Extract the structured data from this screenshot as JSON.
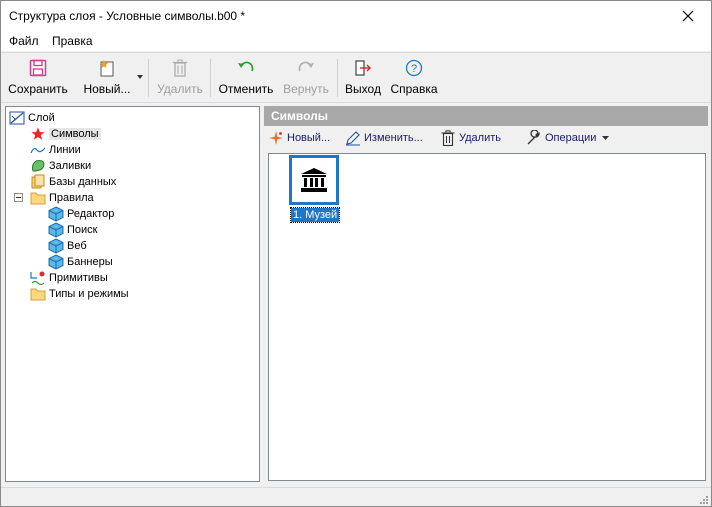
{
  "window": {
    "title": "Структура слоя - Условные символы.b00 *"
  },
  "menu": [
    {
      "label": "Файл"
    },
    {
      "label": "Правка"
    }
  ],
  "toolbar": {
    "save_label": "Сохранить",
    "new_label": "Новый...",
    "delete_label": "Удалить",
    "undo_label": "Отменить",
    "redo_label": "Вернуть",
    "exit_label": "Выход",
    "help_label": "Справка"
  },
  "tree": {
    "items": [
      {
        "label": "Слой",
        "icon": "layer-icon"
      },
      {
        "label": "Символы",
        "icon": "star-icon"
      },
      {
        "label": "Линии",
        "icon": "line-icon"
      },
      {
        "label": "Заливки",
        "icon": "fill-icon"
      },
      {
        "label": "Базы данных",
        "icon": "database-icon"
      },
      {
        "label": "Правила",
        "icon": "folder-icon"
      },
      {
        "label": "Редактор",
        "icon": "cube-icon"
      },
      {
        "label": "Поиск",
        "icon": "cube-icon"
      },
      {
        "label": "Веб",
        "icon": "cube-icon"
      },
      {
        "label": "Баннеры",
        "icon": "cube-icon"
      },
      {
        "label": "Примитивы",
        "icon": "primitives-icon"
      },
      {
        "label": "Типы и режимы",
        "icon": "folder-icon"
      }
    ]
  },
  "right_panel": {
    "header": "Символы",
    "new_label": "Новый...",
    "edit_label": "Изменить...",
    "delete_label": "Удалить",
    "operations_label": "Операции"
  },
  "symbols": [
    {
      "label": "1. Музей",
      "icon": "museum-icon"
    }
  ],
  "colors": {
    "accent": "#1e77c9",
    "header_bg": "#a8a8a8"
  }
}
